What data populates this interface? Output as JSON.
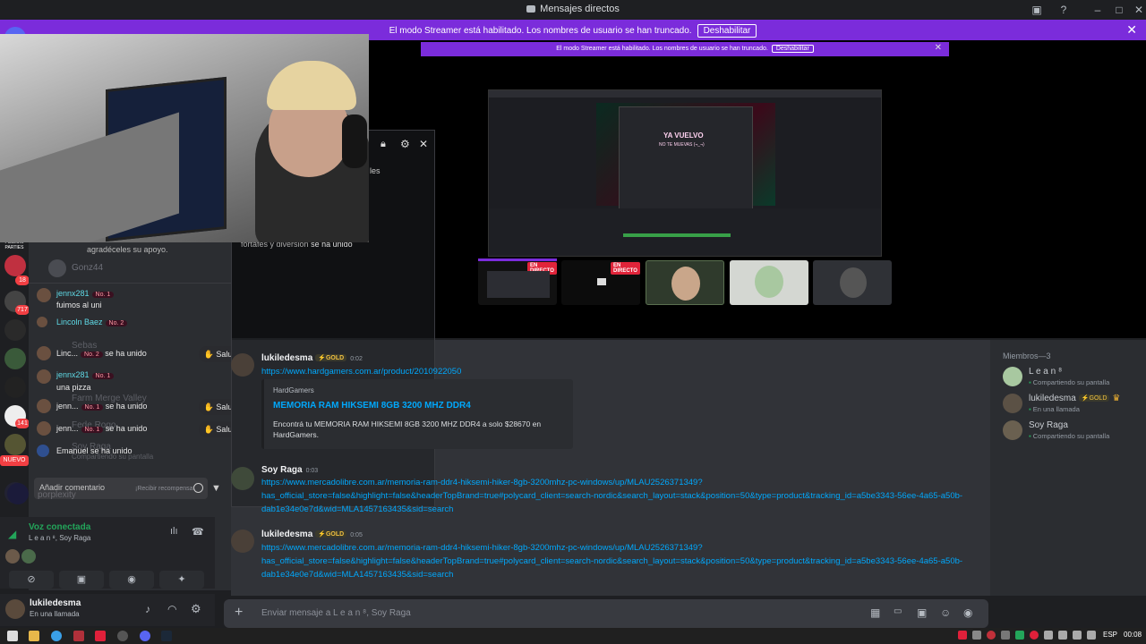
{
  "window": {
    "title": "Mensajes directos"
  },
  "banner": {
    "text": "El modo Streamer está habilitado. Los nombres de usuario se han truncado.",
    "button": "Deshabilitar"
  },
  "rail": {
    "badges": [
      "18",
      "717",
      "141"
    ],
    "new_label": "NUEVO",
    "top_label": "FOLLOW PARTIES"
  },
  "left": {
    "support_text": "agradéceles su apoyo.",
    "ghost_users": [
      "Gonz44",
      "Sebas",
      "Farm Merge Valley",
      "Fede Rogo",
      "Soy Raga"
    ],
    "ghost_sub": "Compartiendo su pantalla"
  },
  "chat": {
    "messages": [
      {
        "name": "jennx281",
        "rank": "No. 1",
        "text": "fuimos al uni"
      },
      {
        "name": "Lincoln Baez",
        "rank": "No. 2",
        "text": ""
      }
    ],
    "joins": [
      {
        "name": "Linc...",
        "rank": "No. 2",
        "action": "se ha unido",
        "button": "Saludar"
      },
      {
        "name": "jenn...",
        "rank": "No. 1",
        "action": "se ha unido",
        "button": "Saludar"
      },
      {
        "name": "jenn...",
        "rank": "No. 1",
        "action": "se ha unido",
        "button": "Saludar"
      }
    ],
    "msg2": {
      "name": "jennx281",
      "rank": "No. 1",
      "text": "una pizza"
    },
    "joined_line": "Emanuel se ha unido",
    "comment_placeholder": "Añadir comentario",
    "reward_text": "¡Recibir recompensa!",
    "ghost_placeholder": "porplexity"
  },
  "popout": {
    "partial": "les",
    "joined_text": "se ha unido",
    "joined_name": "fortafes y diversión"
  },
  "voice": {
    "title": "Voz conectada",
    "sub": "L e a n ⁸, Soy Raga"
  },
  "user": {
    "name": "lukiledesma",
    "status": "En una llamada"
  },
  "stage": {
    "banner_text": "El modo Streamer está habilitado. Los nombres de usuario se han truncado.",
    "banner_button": "Deshabilitar",
    "obs_title": "YA VUELVO",
    "obs_sub": "NO TE MUEVAS (¬_¬)",
    "live_label": "EN DIRECTO"
  },
  "messages": [
    {
      "author": "lukiledesma",
      "badge": "GOLD",
      "time": "0:02",
      "link": "https://www.hardgamers.com.ar/product/2010922050",
      "embed": {
        "site": "HardGamers",
        "title": "MEMORIA RAM HIKSEMI 8GB 3200 MHZ DDR4",
        "desc": "Encontrá tu MEMORIA RAM HIKSEMI 8GB 3200 MHZ DDR4 a solo $28670 en HardGamers."
      }
    },
    {
      "author": "Soy Raga",
      "badge": "",
      "time": "0:03",
      "link": "https://www.mercadolibre.com.ar/memoria-ram-ddr4-hiksemi-hiker-8gb-3200mhz-pc-windows/up/MLAU2526371349?has_official_store=false&highlight=false&headerTopBrand=true#polycard_client=search-nordic&search_layout=stack&position=50&type=product&tracking_id=a5be3343-56ee-4a65-a50b-dab1e34e0e7d&wid=MLA1457163435&sid=search"
    },
    {
      "author": "lukiledesma",
      "badge": "GOLD",
      "time": "0:05",
      "link": "https://www.mercadolibre.com.ar/memoria-ram-ddr4-hiksemi-hiker-8gb-3200mhz-pc-windows/up/MLAU2526371349?has_official_store=false&highlight=false&headerTopBrand=true#polycard_client=search-nordic&search_layout=stack&position=50&type=product&tracking_id=a5be3343-56ee-4a65-a50b-dab1e34e0e7d&wid=MLA1457163435&sid=search"
    }
  ],
  "composer": {
    "placeholder": "Enviar mensaje a L e a n ⁸, Soy Raga"
  },
  "members": {
    "header": "Miembros—3",
    "list": [
      {
        "name": "L e a n ⁸",
        "sub": "Compartiendo su pantalla",
        "badge": ""
      },
      {
        "name": "lukiledesma",
        "sub": "En una llamada",
        "badge": "GOLD"
      },
      {
        "name": "Soy Raga",
        "sub": "Compartiendo su pantalla",
        "badge": ""
      }
    ]
  },
  "taskbar": {
    "lang": "ESP",
    "time": "00:08"
  },
  "colors": {
    "blurple": "#5865f2",
    "streamer": "#7b2cdb",
    "link": "#00a8fc",
    "online": "#23a55a",
    "live": "#e0243a"
  }
}
